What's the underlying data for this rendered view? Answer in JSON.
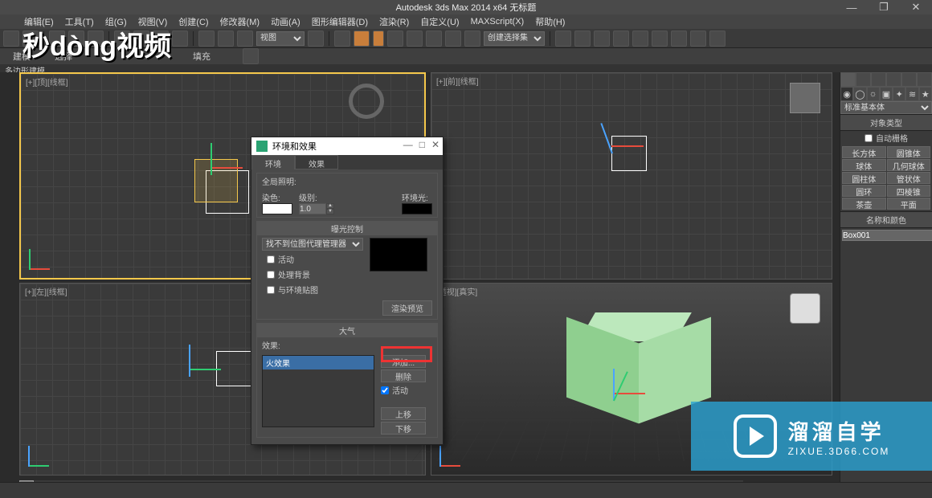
{
  "app": {
    "title": "Autodesk 3ds Max  2014 x64   无标题",
    "window_controls": {
      "min": "—",
      "restore": "❐",
      "close": "✕"
    }
  },
  "menu": [
    "编辑(E)",
    "工具(T)",
    "组(G)",
    "视图(V)",
    "创建(C)",
    "修改器(M)",
    "动画(A)",
    "图形编辑器(D)",
    "渲染(R)",
    "自定义(U)",
    "MAXScript(X)",
    "帮助(H)"
  ],
  "toolbar": {
    "view_dropdown": "视图",
    "selectset_placeholder": "创建选择集"
  },
  "ribbon": {
    "modeling": "建模",
    "selection": "选择",
    "fill": "填充"
  },
  "subheader": "多边形建模",
  "viewports": {
    "top": "[+][顶][线框]",
    "front": "[+][前][线框]",
    "left": "[+][左][线框]",
    "persp": "[透视][真实]"
  },
  "cmdpanel": {
    "dropdown": "标准基本体",
    "rollout_objtype": "对象类型",
    "autogrid": "自动栅格",
    "buttons": [
      "长方体",
      "圆锥体",
      "球体",
      "几何球体",
      "圆柱体",
      "管状体",
      "圆环",
      "四棱锥",
      "茶壶",
      "平面"
    ],
    "rollout_namecolor": "名称和颜色",
    "obj_name": "Box001"
  },
  "dialog": {
    "title": "环境和效果",
    "controls": {
      "min": "—",
      "max": "□",
      "close": "✕"
    },
    "tabs": {
      "env": "环境",
      "fx": "效果"
    },
    "bg_section": "全局照明:",
    "labels": {
      "tint": "染色:",
      "level": "级别:",
      "ambient": "环境光:"
    },
    "level_value": "1.0",
    "exposure_head": "曝光控制",
    "exposure_dropdown": "找不到位图代理管理器",
    "chk_active": "活动",
    "chk_bg": "处理背景",
    "chk_env": "与环境贴图",
    "render_preview": "渲染预览",
    "atmos_head": "大气",
    "effects_label": "效果:",
    "fx_item": "火效果",
    "btn_add": "添加...",
    "btn_del": "删除",
    "chk_active2": "活动",
    "btn_up": "上移",
    "btn_down": "下移"
  },
  "watermarks": {
    "top_logo": "秒dòng视频",
    "corner_big": "溜溜自学",
    "corner_small": "ZIXUE.3D66.COM"
  }
}
